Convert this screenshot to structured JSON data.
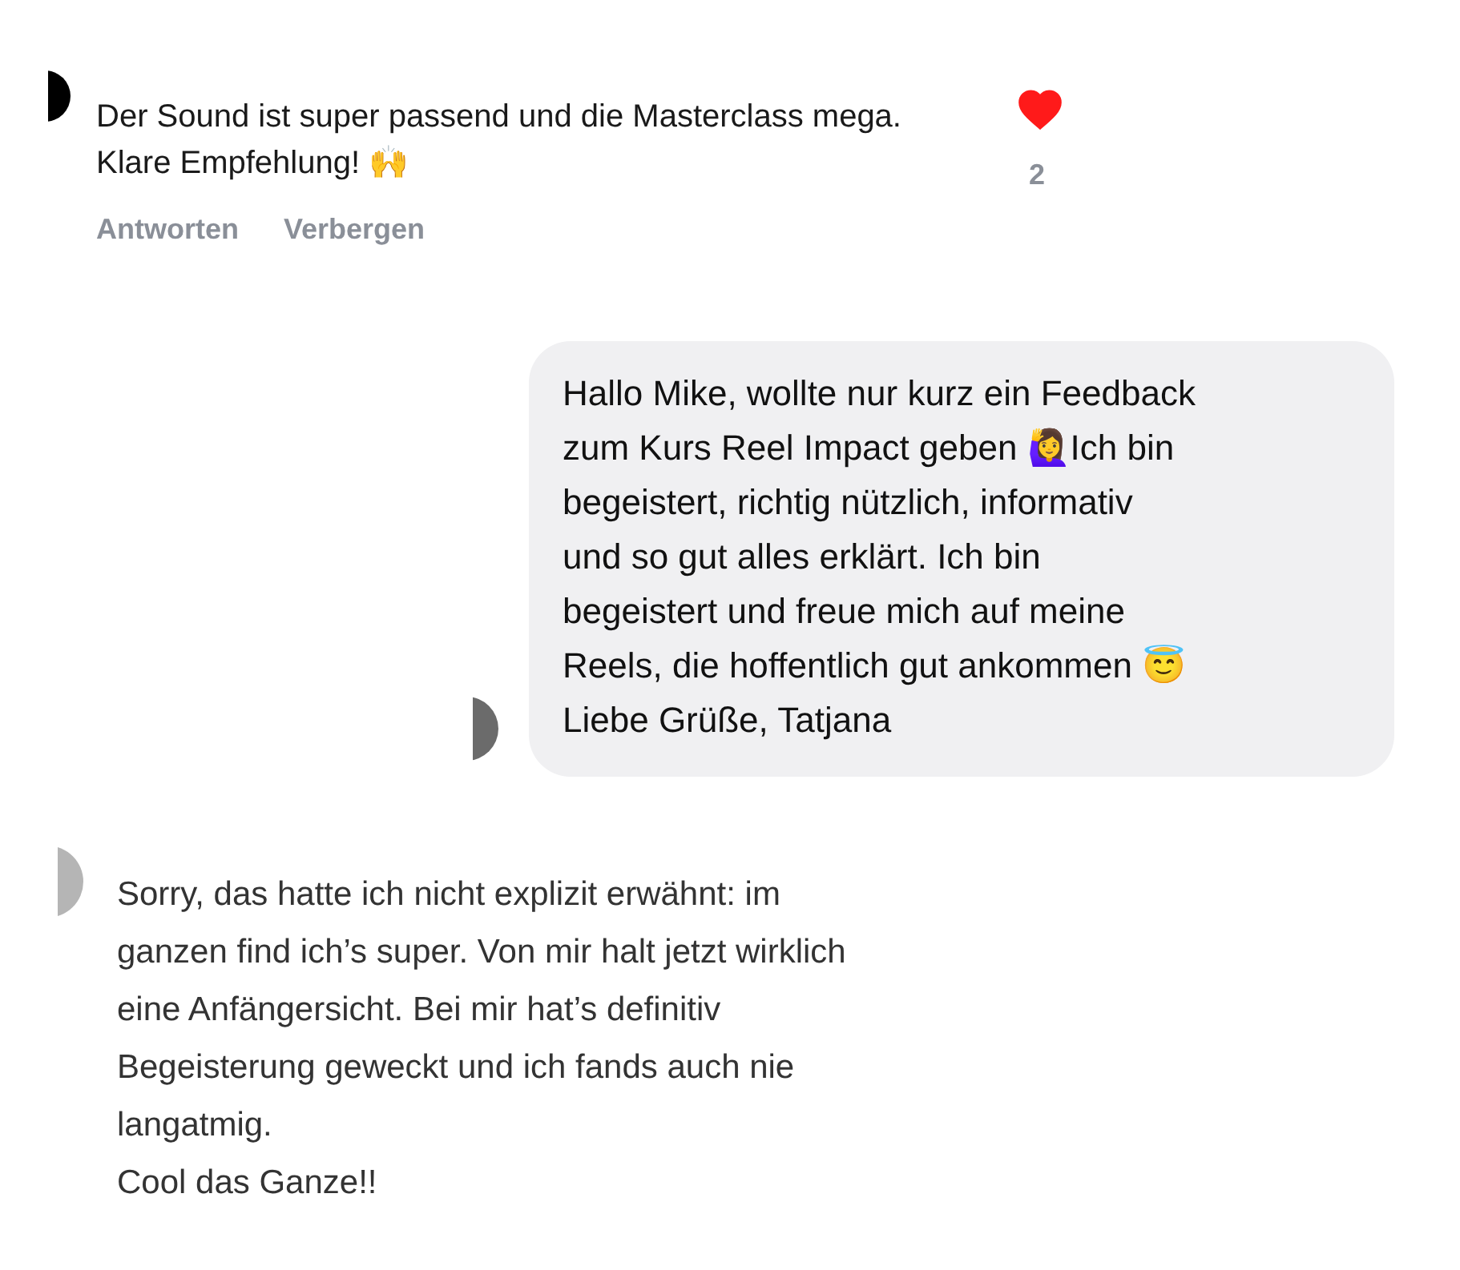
{
  "comment": {
    "text": "Der Sound ist super passend und die Masterclass mega. Klare Empfehlung! 🙌",
    "likes": "2",
    "liked": true,
    "actions": [
      "Antworten",
      "Verbergen"
    ]
  },
  "message": {
    "lines": [
      "Hallo Mike, wollte nur kurz ein Feedback",
      "zum Kurs Reel Impact geben 🙋‍♀️Ich bin",
      "begeistert, richtig nützlich, informativ",
      "und so gut alles erklärt. Ich bin",
      "begeistert und freue mich auf meine",
      "Reels, die hoffentlich gut ankommen 😇",
      "Liebe Grüße, Tatjana"
    ]
  },
  "post": {
    "lines": [
      "Sorry, das hatte ich nicht explizit erwähnt: im",
      "ganzen find ich’s super. Von mir halt jetzt wirklich",
      "eine Anfängersicht. Bei mir hat’s definitiv",
      "Begeisterung geweckt und ich fands auch nie",
      "langatmig.",
      "Cool das Ganze!!"
    ]
  }
}
